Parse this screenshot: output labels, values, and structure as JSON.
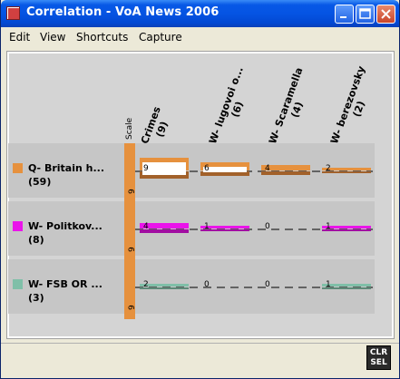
{
  "window": {
    "title": "Correlation - VoA News 2006",
    "controls": [
      "minimize",
      "maximize",
      "close"
    ]
  },
  "menu": [
    "Edit",
    "View",
    "Shortcuts",
    "Capture"
  ],
  "scale_label": "Scale",
  "columns": [
    {
      "name": "Crimes",
      "count": "(9)"
    },
    {
      "name": "W- lugovoi o...",
      "count": "(6)"
    },
    {
      "name": "W- Scaramella",
      "count": "(4)"
    },
    {
      "name": "W- berezovsky",
      "count": "(2)"
    }
  ],
  "rows": [
    {
      "name": "Q- Britain h...",
      "count": "(59)",
      "color": "#e6913e",
      "scale_max": "9",
      "cells": [
        {
          "value": "9",
          "fill": "#e6913e",
          "dark": "#a2612a"
        },
        {
          "value": "6",
          "fill": "#e6913e",
          "dark": "#a2612a"
        },
        {
          "value": "4",
          "fill": "#e6913e",
          "dark": "#a2612a"
        },
        {
          "value": "2",
          "fill": "#e6913e",
          "dark": "#a2612a"
        }
      ]
    },
    {
      "name": "W- Politkov...",
      "count": "(8)",
      "color": "#ea14ea",
      "scale_max": "9",
      "cells": [
        {
          "value": "4",
          "fill": "#ea14ea",
          "dark": "#a10ea1"
        },
        {
          "value": "1",
          "fill": "#ea14ea",
          "dark": "#a10ea1"
        },
        {
          "value": "0",
          "fill": "#ea14ea",
          "dark": "#a10ea1"
        },
        {
          "value": "1",
          "fill": "#ea14ea",
          "dark": "#a10ea1"
        }
      ]
    },
    {
      "name": "W- FSB OR ...",
      "count": "(3)",
      "color": "#7fbfa8",
      "scale_max": "9",
      "cells": [
        {
          "value": "2",
          "fill": "#7fbfa8",
          "dark": "#5d8a78"
        },
        {
          "value": "0",
          "fill": "#7fbfa8",
          "dark": "#5d8a78"
        },
        {
          "value": "0",
          "fill": "#7fbfa8",
          "dark": "#5d8a78"
        },
        {
          "value": "1",
          "fill": "#7fbfa8",
          "dark": "#5d8a78"
        }
      ]
    }
  ],
  "clear_button": {
    "line1": "CLR",
    "line2": "SEL"
  }
}
